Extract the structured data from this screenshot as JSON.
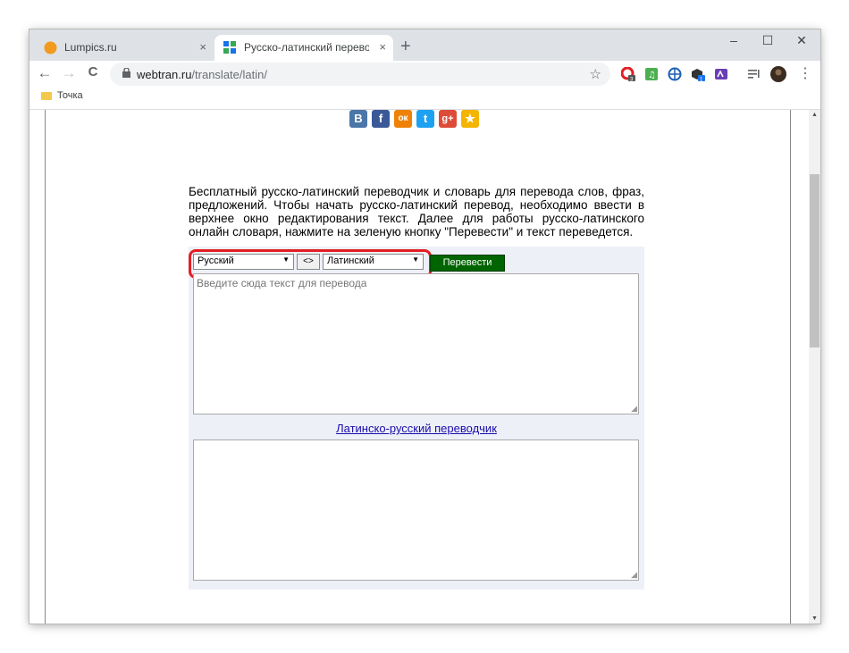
{
  "tabs": [
    {
      "title": "Lumpics.ru",
      "close": "×",
      "favicon": "lumpics-orange-circle"
    },
    {
      "title": "Русско-латинский переводчик о",
      "close": "×",
      "favicon": "webtran-grid"
    }
  ],
  "window_controls": {
    "new_tab": "+",
    "minimize": "–",
    "maximize": "☐",
    "close": "✕"
  },
  "toolbar": {
    "back": "←",
    "forward": "→",
    "reload": "C",
    "url_host": "webtran.ru",
    "url_path": "/translate/latin/",
    "bookmark_star": "☆",
    "menu": "⋮",
    "extensions": [
      "opera-ext-icon",
      "music-ext-icon",
      "globe-ext-icon",
      "box-ext-icon",
      "reader-ext-icon",
      "playlist-icon",
      "profile-avatar"
    ],
    "ext_badges": {
      "opera": "3",
      "box": "1"
    }
  },
  "bookmarks": [
    {
      "label": "Точка"
    }
  ],
  "share": {
    "icons": [
      "vk-icon",
      "facebook-icon",
      "odnoklassniki-icon",
      "twitter-icon",
      "googleplus-icon",
      "favorite-icon"
    ],
    "glyphs": [
      "В",
      "f",
      "ок",
      "t",
      "g+",
      "★"
    ]
  },
  "page": {
    "description": "Бесплатный русско-латинский переводчик и словарь для перевода слов, фраз, предложений. Чтобы начать русско-латинский перевод, необходимо ввести в верхнее окно редактирования текст. Далее для работы русско-латинского онлайн словаря, нажмите на зеленую кнопку \"Перевести\" и текст переведется.",
    "source_lang": "Русский",
    "swap_label": "<>",
    "target_lang": "Латинский",
    "translate_button": "Перевести",
    "input_placeholder": "Введите сюда текст для перевода",
    "reverse_link": "Латинско-русский переводчик"
  },
  "colors": {
    "translate_button": "#006400",
    "highlight": "#e31e24",
    "link": "#1a0dab",
    "panel_bg": "#eef0f8"
  }
}
